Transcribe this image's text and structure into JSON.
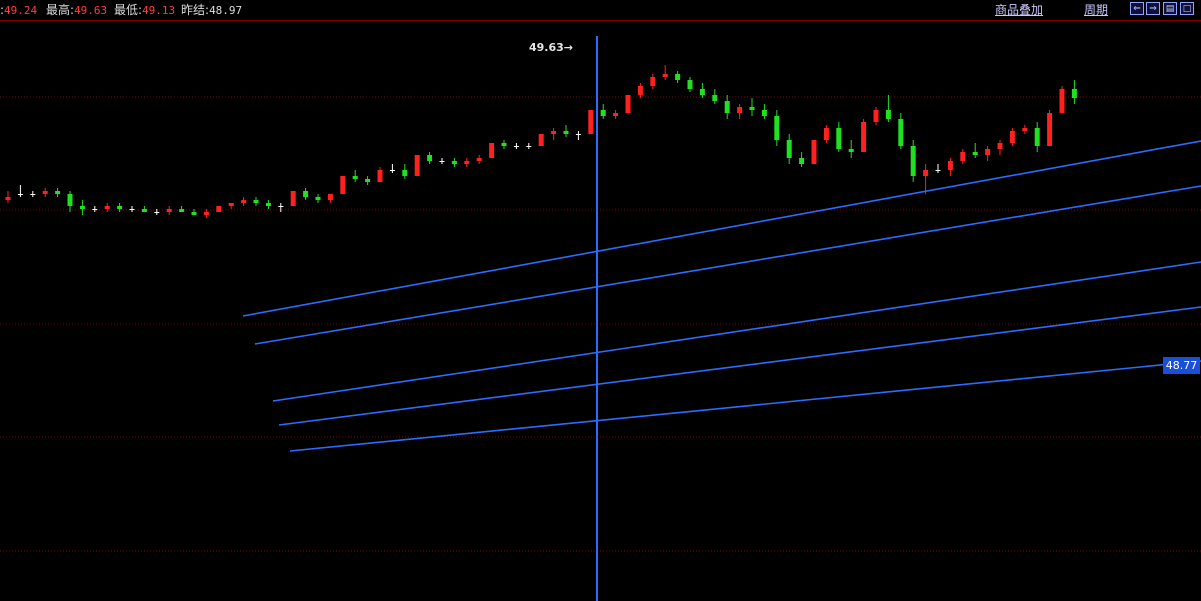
{
  "quote_bar": {
    "open_label": "",
    "open_value": "49.24",
    "high_label": "最高",
    "high_value": "49.63",
    "low_label": "最低",
    "low_value": "49.13",
    "prev_close_label": "昨结",
    "prev_close_value": "48.97"
  },
  "menu": {
    "overlay_label": "商品叠加",
    "period_label": "周期"
  },
  "toolbar_icons": [
    "shrink-left-icon",
    "expand-right-icon",
    "split-view-icon",
    "single-view-icon"
  ],
  "colors": {
    "background": "#000000",
    "up_candle": "#ff2020",
    "down_candle": "#20e020",
    "doji": "#ffffff",
    "grid": "#7f0000",
    "trend_line": "#2b6bff",
    "cursor_line": "#2b6bff"
  },
  "chart_data": {
    "type": "candlestick",
    "high_marker": "49.63",
    "cursor_price_label": "48.77",
    "series": [
      {
        "values": [
          [
            49.18,
            49.21,
            49.17,
            49.19
          ],
          [
            49.2,
            49.23,
            49.19,
            49.2
          ],
          [
            49.2,
            49.21,
            49.19,
            49.2
          ],
          [
            49.2,
            49.22,
            49.19,
            49.21
          ],
          [
            49.21,
            49.22,
            49.19,
            49.2
          ],
          [
            49.2,
            49.21,
            49.14,
            49.16
          ],
          [
            49.16,
            49.18,
            49.13,
            49.15
          ],
          [
            49.15,
            49.16,
            49.14,
            49.15
          ],
          [
            49.15,
            49.17,
            49.14,
            49.16
          ],
          [
            49.16,
            49.17,
            49.14,
            49.15
          ],
          [
            49.15,
            49.16,
            49.14,
            49.15
          ],
          [
            49.15,
            49.16,
            49.14,
            49.14
          ],
          [
            49.14,
            49.15,
            49.13,
            49.14
          ],
          [
            49.14,
            49.16,
            49.13,
            49.15
          ],
          [
            49.15,
            49.16,
            49.14,
            49.14
          ],
          [
            49.14,
            49.15,
            49.13,
            49.13
          ],
          [
            49.13,
            49.15,
            49.12,
            49.14
          ],
          [
            49.14,
            49.16,
            49.14,
            49.16
          ],
          [
            49.16,
            49.17,
            49.15,
            49.17
          ],
          [
            49.17,
            49.19,
            49.16,
            49.18
          ],
          [
            49.18,
            49.19,
            49.16,
            49.17
          ],
          [
            49.17,
            49.18,
            49.15,
            49.16
          ],
          [
            49.16,
            49.17,
            49.14,
            49.16
          ],
          [
            49.16,
            49.21,
            49.16,
            49.21
          ],
          [
            49.21,
            49.22,
            49.18,
            49.19
          ],
          [
            49.19,
            49.2,
            49.17,
            49.18
          ],
          [
            49.18,
            49.2,
            49.17,
            49.2
          ],
          [
            49.2,
            49.26,
            49.2,
            49.26
          ],
          [
            49.26,
            49.28,
            49.24,
            49.25
          ],
          [
            49.25,
            49.26,
            49.23,
            49.24
          ],
          [
            49.24,
            49.29,
            49.24,
            49.28
          ],
          [
            49.28,
            49.3,
            49.27,
            49.28
          ],
          [
            49.28,
            49.3,
            49.25,
            49.26
          ],
          [
            49.26,
            49.33,
            49.26,
            49.33
          ],
          [
            49.33,
            49.34,
            49.3,
            49.31
          ],
          [
            49.31,
            49.32,
            49.3,
            49.31
          ],
          [
            49.31,
            49.32,
            49.29,
            49.3
          ],
          [
            49.3,
            49.32,
            49.29,
            49.31
          ],
          [
            49.31,
            49.33,
            49.3,
            49.32
          ],
          [
            49.32,
            49.37,
            49.32,
            49.37
          ],
          [
            49.37,
            49.38,
            49.35,
            49.36
          ],
          [
            49.36,
            49.37,
            49.35,
            49.36
          ],
          [
            49.36,
            49.37,
            49.35,
            49.36
          ],
          [
            49.36,
            49.4,
            49.36,
            49.4
          ],
          [
            49.4,
            49.42,
            49.38,
            49.41
          ],
          [
            49.41,
            49.43,
            49.39,
            49.4
          ],
          [
            49.4,
            49.41,
            49.38,
            49.4
          ],
          [
            49.4,
            49.48,
            49.4,
            49.48
          ],
          [
            49.48,
            49.5,
            49.45,
            49.46
          ],
          [
            49.46,
            49.48,
            49.45,
            49.47
          ],
          [
            49.47,
            49.53,
            49.47,
            49.53
          ],
          [
            49.53,
            49.57,
            49.52,
            49.56
          ],
          [
            49.56,
            49.6,
            49.55,
            49.59
          ],
          [
            49.59,
            49.63,
            49.58,
            49.6
          ],
          [
            49.6,
            49.61,
            49.57,
            49.58
          ],
          [
            49.58,
            49.59,
            49.54,
            49.55
          ],
          [
            49.55,
            49.57,
            49.52,
            49.53
          ],
          [
            49.53,
            49.55,
            49.5,
            49.51
          ],
          [
            49.51,
            49.53,
            49.45,
            49.47
          ],
          [
            49.47,
            49.5,
            49.45,
            49.49
          ],
          [
            49.49,
            49.52,
            49.46,
            49.48
          ],
          [
            49.48,
            49.5,
            49.45,
            49.46
          ],
          [
            49.46,
            49.48,
            49.36,
            49.38
          ],
          [
            49.38,
            49.4,
            49.3,
            49.32
          ],
          [
            49.32,
            49.34,
            49.29,
            49.3
          ],
          [
            49.3,
            49.38,
            49.3,
            49.38
          ],
          [
            49.38,
            49.43,
            49.37,
            49.42
          ],
          [
            49.42,
            49.44,
            49.34,
            49.35
          ],
          [
            49.35,
            49.38,
            49.32,
            49.34
          ],
          [
            49.34,
            49.45,
            49.34,
            49.44
          ],
          [
            49.44,
            49.49,
            49.43,
            49.48
          ],
          [
            49.48,
            49.53,
            49.44,
            49.45
          ],
          [
            49.45,
            49.47,
            49.35,
            49.36
          ],
          [
            49.36,
            49.38,
            49.24,
            49.26
          ],
          [
            49.26,
            49.3,
            49.2,
            49.28
          ],
          [
            49.28,
            49.3,
            49.27,
            49.28
          ],
          [
            49.28,
            49.32,
            49.26,
            49.31
          ],
          [
            49.31,
            49.35,
            49.3,
            49.34
          ],
          [
            49.34,
            49.37,
            49.32,
            49.33
          ],
          [
            49.33,
            49.36,
            49.31,
            49.35
          ],
          [
            49.35,
            49.38,
            49.33,
            49.37
          ],
          [
            49.37,
            49.42,
            49.36,
            49.41
          ],
          [
            49.41,
            49.43,
            49.4,
            49.42
          ],
          [
            49.42,
            49.44,
            49.34,
            49.36
          ],
          [
            49.36,
            49.48,
            49.36,
            49.47
          ],
          [
            49.47,
            49.56,
            49.47,
            49.55
          ],
          [
            49.55,
            49.58,
            49.5,
            49.52
          ]
        ]
      }
    ],
    "grid": true
  }
}
